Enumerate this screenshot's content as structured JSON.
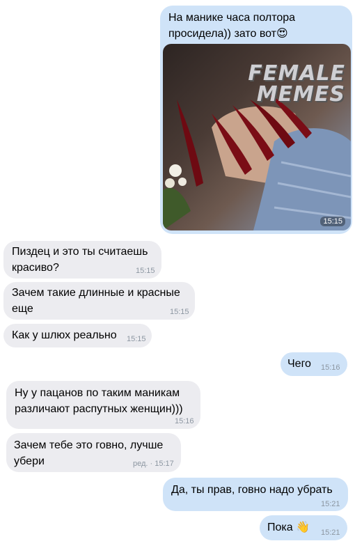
{
  "messages": [
    {
      "dir": "out",
      "text": "На манике часа полтора\nпросидела)) зато вот😍"
    },
    {
      "dir": "in",
      "text": "Пиздец и это ты считаешь\nкрасиво?",
      "time": "15:15"
    },
    {
      "dir": "in",
      "text": "Зачем такие длинные и красные\nеще",
      "time": "15:15"
    },
    {
      "dir": "in",
      "text": "Как у шлюх реально",
      "time": "15:15"
    },
    {
      "dir": "out",
      "text": "Чего",
      "time": "15:16"
    },
    {
      "dir": "in",
      "text": "Ну у пацанов по таким маникам\nразличают распутных женщин)))",
      "time": "15:16"
    },
    {
      "dir": "in",
      "text": "Зачем тебе это говно, лучше\nубери",
      "time": "ред. · 15:17"
    },
    {
      "dir": "out",
      "text": "Да, ты прав, говно надо убрать",
      "time": "15:21"
    },
    {
      "dir": "out",
      "text": "Пока 👋",
      "time": "15:21"
    }
  ],
  "photo": {
    "time": "15:15",
    "watermark": "FEMALE\nMEMES"
  }
}
